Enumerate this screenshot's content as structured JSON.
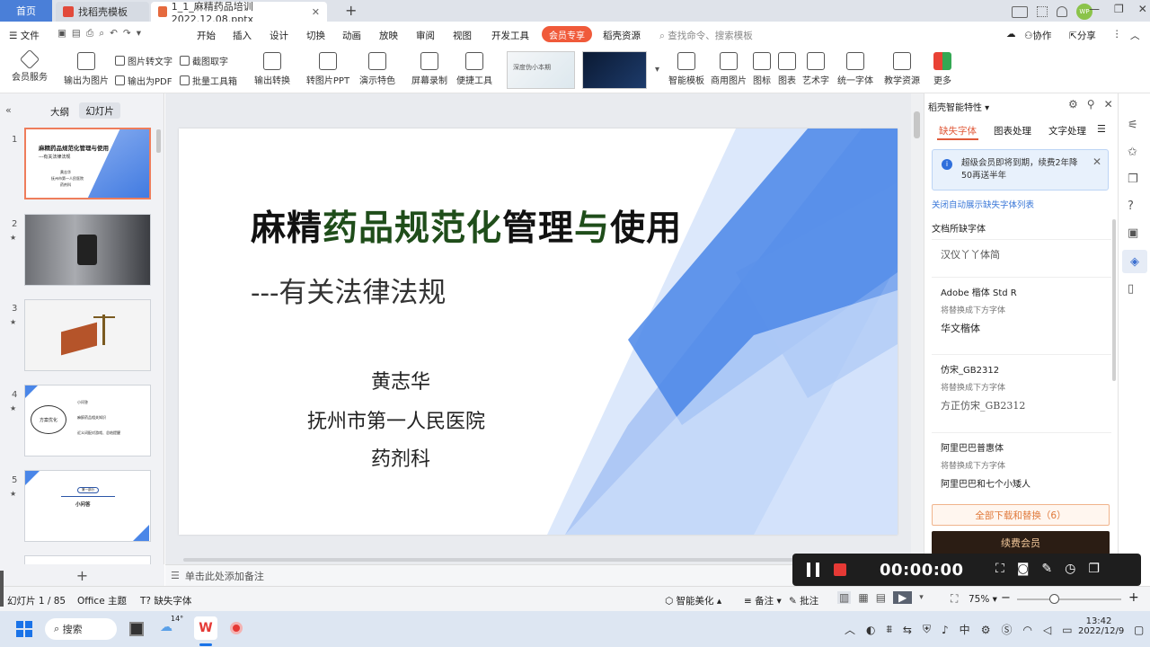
{
  "titlebar": {
    "tabs": [
      {
        "label": "首页"
      },
      {
        "label": "找稻壳模板"
      },
      {
        "label": "1_1_麻精药品培训2022.12.08.pptx"
      }
    ],
    "new_tab": "+",
    "user_initials": "WP"
  },
  "menubar": {
    "file": "文件",
    "items": [
      "开始",
      "插入",
      "设计",
      "切换",
      "动画",
      "放映",
      "审阅",
      "视图",
      "开发工具"
    ],
    "vip": "会员专享",
    "docer": "稻壳资源",
    "search_placeholder": "查找命令、搜索模板",
    "collab": "协作",
    "share": "分享"
  },
  "ribbon": {
    "member_services": "会员服务",
    "export_image": "输出为图片",
    "image_to_text": "图片转文字",
    "export_pdf": "输出为PDF",
    "screenshot_text": "截图取字",
    "batch_tools": "批量工具箱",
    "output_convert": "输出转换",
    "to_image_ppt": "转图片PPT",
    "demo_features": "演示特色",
    "screen_record": "屏幕录制",
    "quick_tools": "便捷工具",
    "smart_template": "智能模板",
    "stock_image": "商用图片",
    "icons": "图标",
    "charts": "图表",
    "art_text": "艺术字",
    "unify_font": "统一字体",
    "teaching": "教学资源",
    "more": "更多",
    "template_preview_1": "深度伪小本期",
    "template_preview_2": ""
  },
  "leftpanel": {
    "tab_outline": "大纲",
    "tab_slides": "幻灯片",
    "slides": [
      {
        "num": "1",
        "title": "麻精药品规范化管理与使用",
        "sub": "---有关法律法规",
        "l1": "黄志华",
        "l2": "抚州市第一人民医院",
        "l3": "药剂科"
      },
      {
        "num": "2"
      },
      {
        "num": "3"
      },
      {
        "num": "4",
        "center": "方案优化",
        "items": [
          "小问答",
          "麻醉药品相关知识",
          "近义词配对游戏、总结提醒"
        ]
      },
      {
        "num": "5",
        "chip": "第一部分",
        "title": "小问答"
      }
    ],
    "add": "+"
  },
  "slide": {
    "title_part1": "麻精",
    "title_part2": "药品规范化",
    "title_part3": "管理",
    "title_part4": "与",
    "title_part5": "使用",
    "subtitle": "---有关法律法规",
    "author": "黄志华",
    "hospital": "抚州市第一人民医院",
    "department": "药剂科",
    "colors": {
      "title_black": "#111111",
      "title_green": "#1f4d1a",
      "accent_blue": "#4a86e8"
    }
  },
  "notes": {
    "placeholder": "单击此处添加备注"
  },
  "rightpanel": {
    "title": "稻壳智能特性",
    "tabs": [
      "缺失字体",
      "图表处理",
      "文字处理"
    ],
    "notice": "超级会员即将到期，续费2年降50再送半年",
    "auto_link": "关闭自动展示缺失字体列表",
    "section": "文档所缺字体",
    "fonts": [
      {
        "name": "",
        "preview": "汉仪丫丫体简"
      },
      {
        "name": "Adobe 楷体 Std R",
        "replace": "将替换成下方字体",
        "preview": "华文楷体"
      },
      {
        "name": "仿宋_GB2312",
        "replace": "将替换成下方字体",
        "preview": "方正仿宋_GB2312"
      },
      {
        "name": "阿里巴巴普惠体",
        "replace": "将替换成下方字体",
        "preview": "阿里巴巴和七个小矮人"
      }
    ],
    "download_all": "全部下载和替换（6）",
    "renew": "续费会员"
  },
  "recorder": {
    "time": "00:00:00"
  },
  "statusbar": {
    "slide_count": "幻灯片 1 / 85",
    "theme": "Office 主题",
    "missing_font": "缺失字体",
    "beautify": "智能美化",
    "notes": "备注",
    "comments": "批注",
    "zoom": "75%"
  },
  "taskbar": {
    "search": "搜索",
    "weather": "14°",
    "time": "13:42",
    "date": "2022/12/9"
  }
}
